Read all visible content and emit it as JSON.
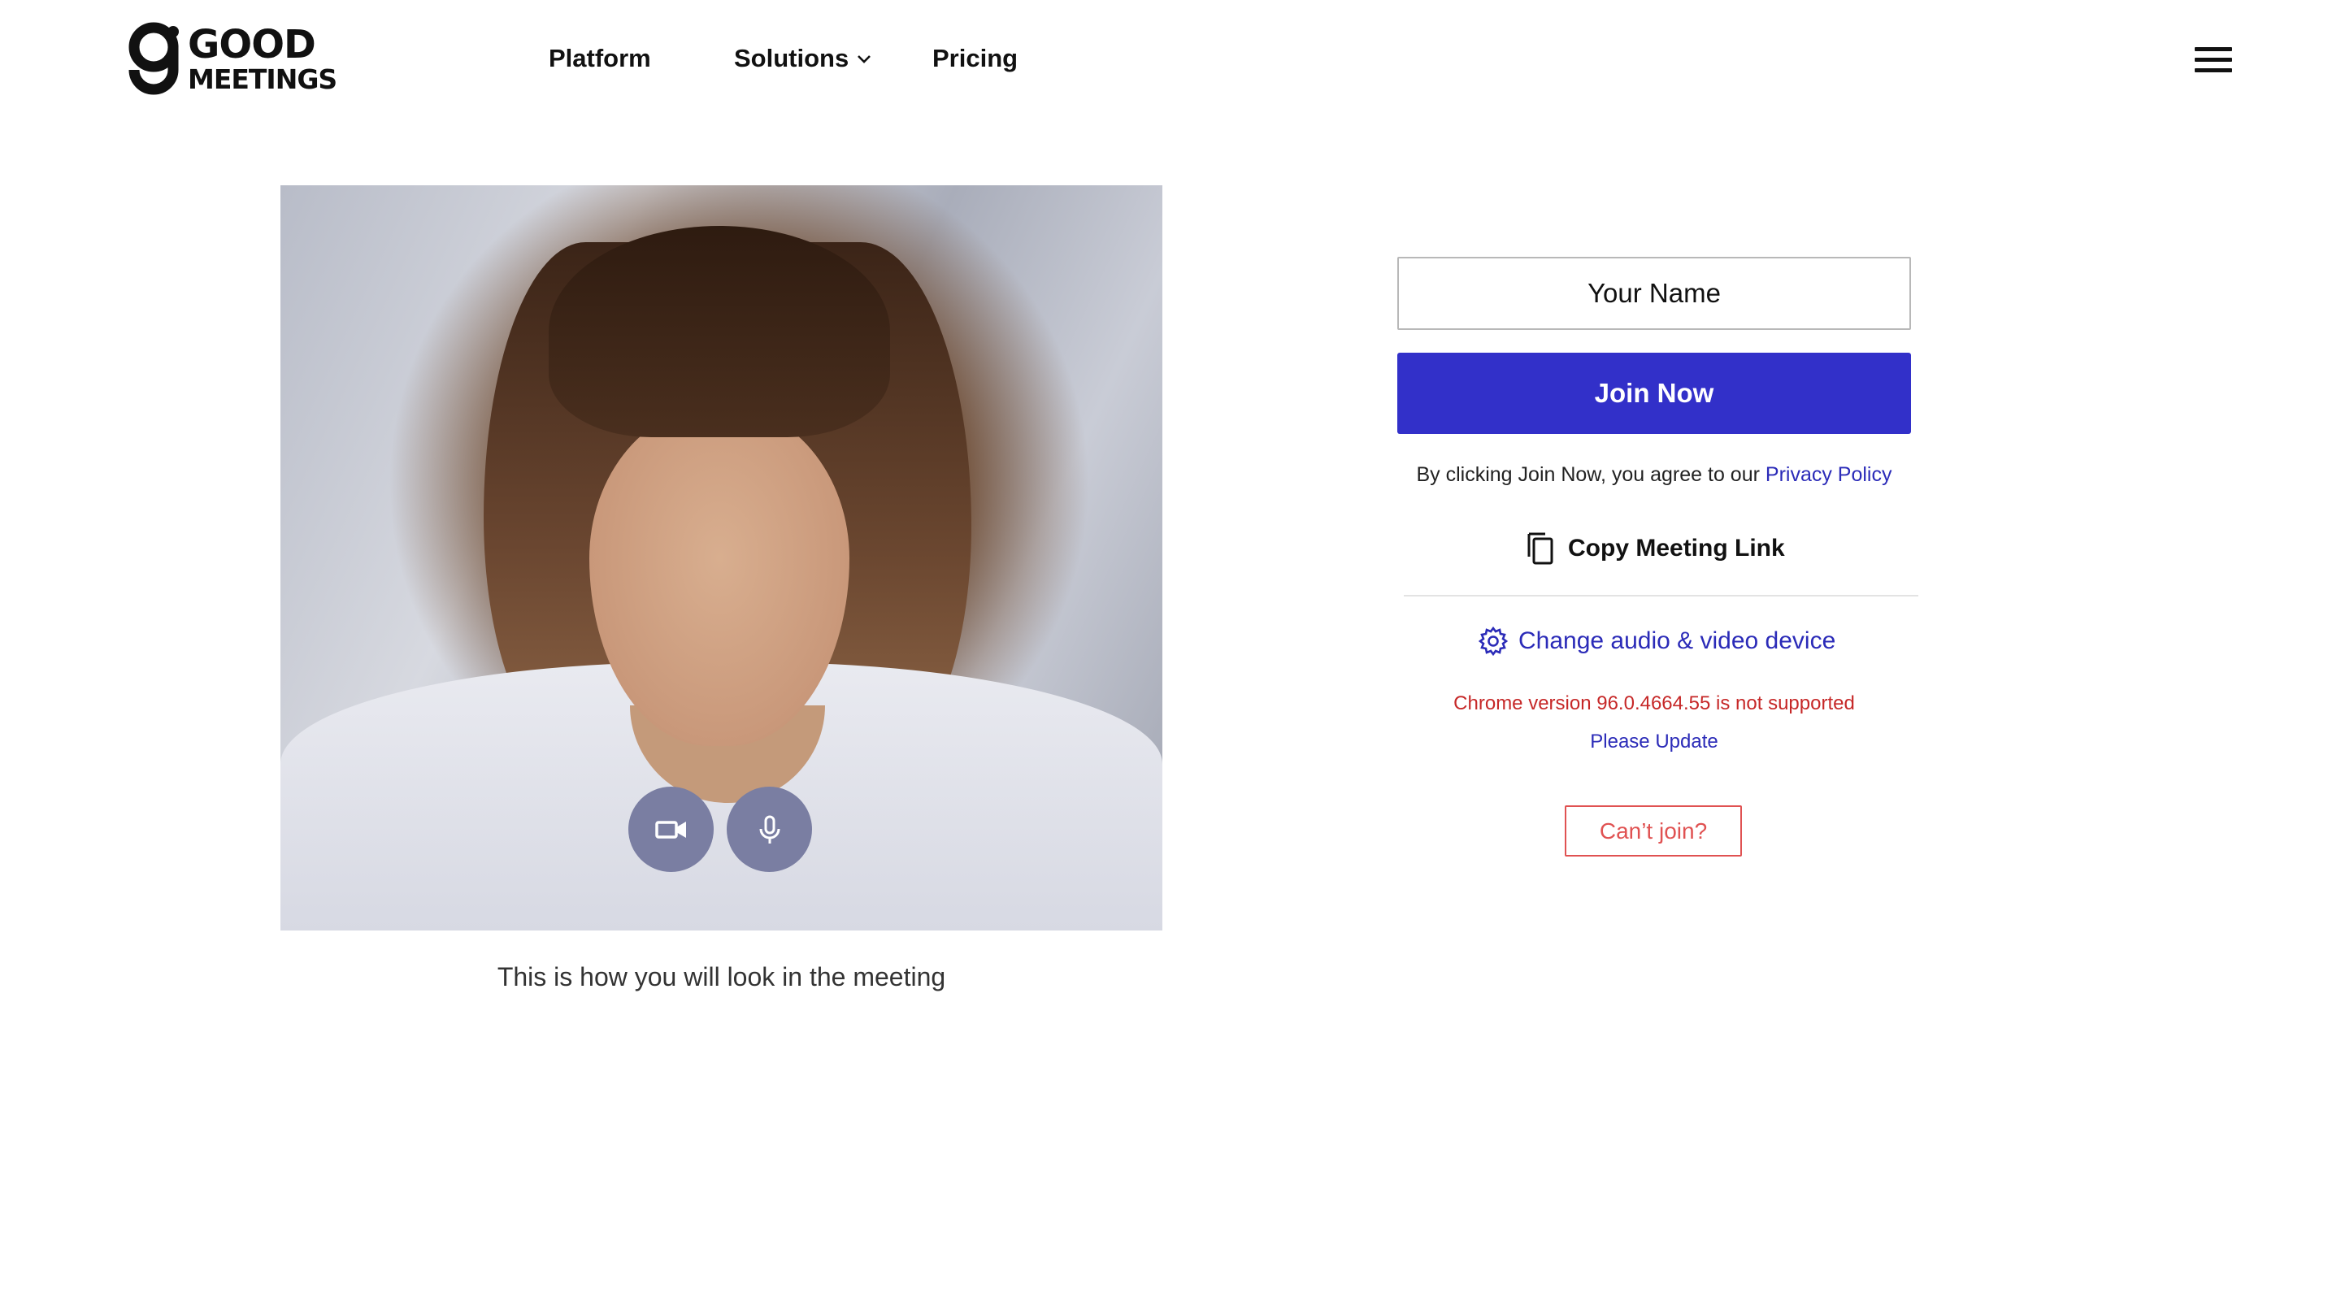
{
  "brand": {
    "logo_line1": "GOOD",
    "logo_line2": "MEETINGS"
  },
  "nav": {
    "platform": "Platform",
    "solutions": "Solutions",
    "pricing": "Pricing"
  },
  "preview": {
    "caption": "This is how you will look in the meeting",
    "camera_icon": "video-camera-icon",
    "mic_icon": "microphone-icon"
  },
  "join_form": {
    "name_placeholder": "Your Name",
    "join_label": "Join Now",
    "agree_text": "By clicking Join Now, you agree to our ",
    "privacy_link": "Privacy Policy",
    "copy_link_label": "Copy Meeting Link",
    "device_link_label": "Change audio & video device",
    "browser_warning": "Chrome version 96.0.4664.55 is not supported",
    "update_link": "Please Update",
    "cant_join_label": "Can’t join?"
  },
  "colors": {
    "primary": "#3230c9",
    "link": "#2b2bb8",
    "warning": "#c62828",
    "cant_join": "#e05252",
    "control_bg": "#7a7ea2"
  }
}
